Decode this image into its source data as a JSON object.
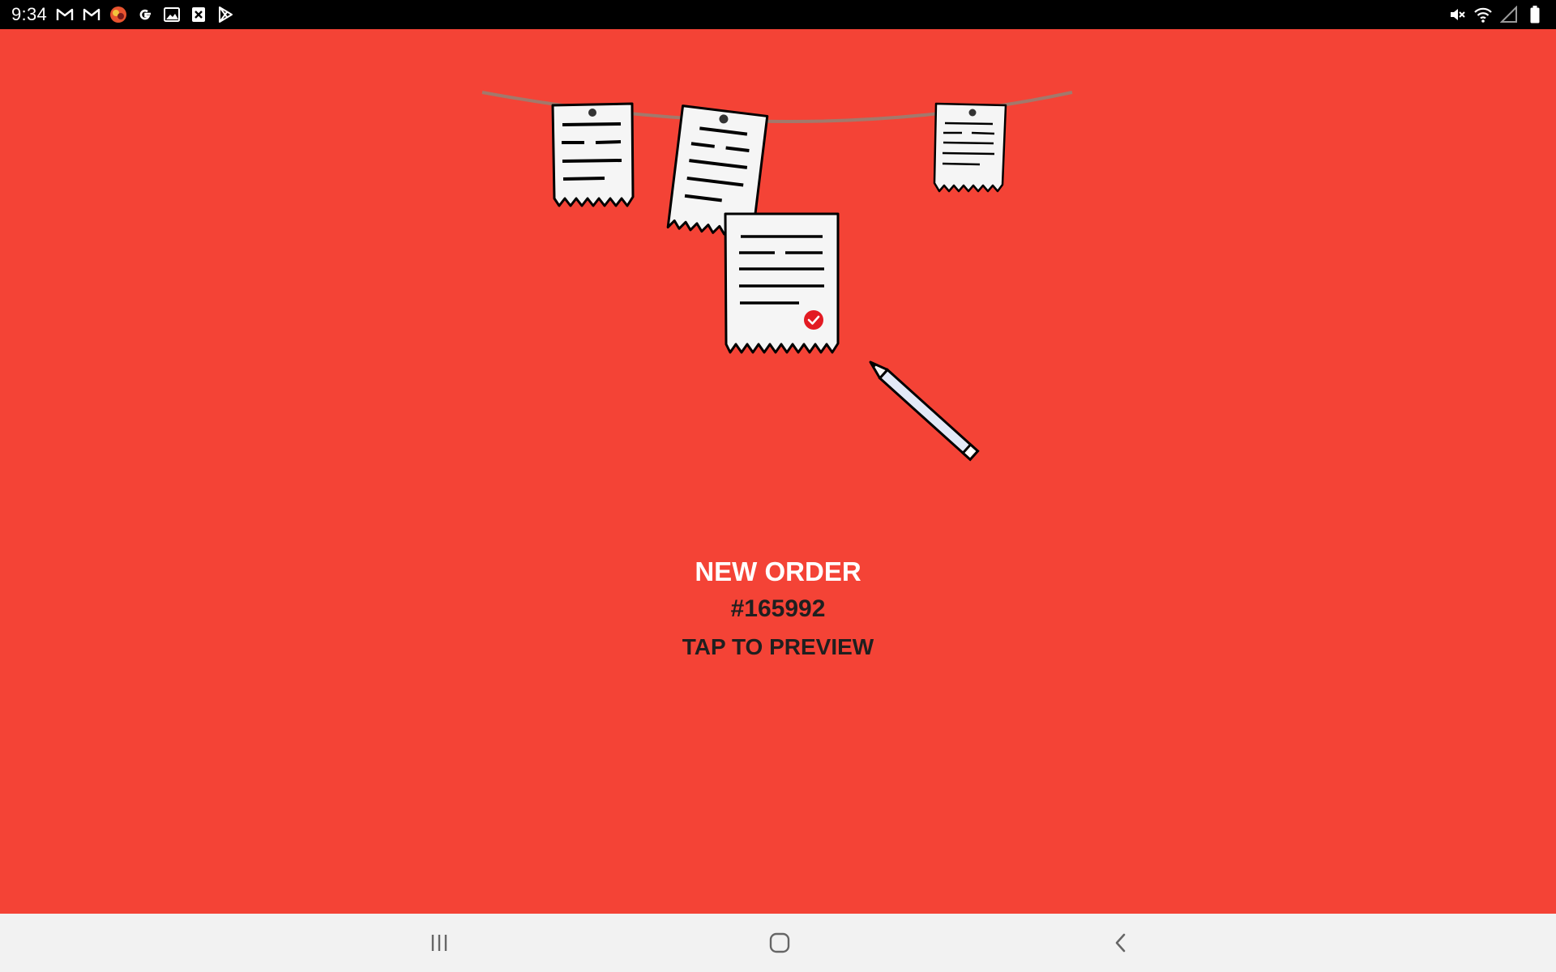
{
  "status_bar": {
    "time": "9:34",
    "notification_icons": [
      "gmail-icon",
      "gmail-icon",
      "app-avatar-icon",
      "google-icon",
      "gallery-icon",
      "x-app-icon",
      "play-store-icon"
    ],
    "system_icons": [
      "mute-icon",
      "wifi-icon",
      "signal-icon",
      "battery-icon"
    ]
  },
  "order": {
    "title": "NEW ORDER",
    "number": "#165992",
    "cta": "TAP TO PREVIEW"
  },
  "colors": {
    "background": "#f44336",
    "title_text": "#ffffff",
    "body_text": "#1f1f1f",
    "nav_bar": "#f2f2f2",
    "check_badge": "#e31b23"
  },
  "nav_bar": {
    "buttons": [
      "recents-icon",
      "home-icon",
      "back-icon"
    ]
  }
}
